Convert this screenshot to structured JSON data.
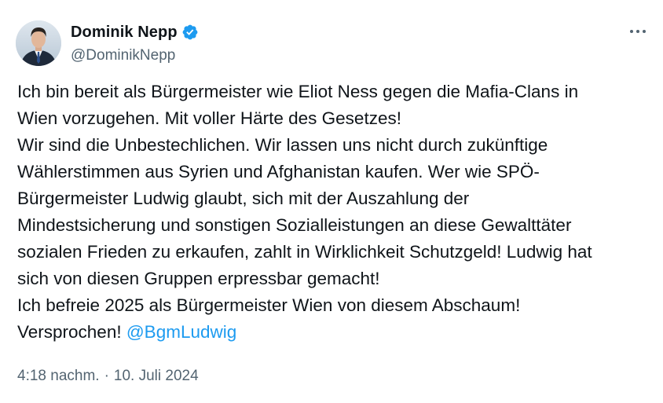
{
  "author": {
    "display_name": "Dominik Nepp",
    "handle": "@DominikNepp",
    "avatar_icon": "profile-photo",
    "verified_icon": "verified-badge-icon",
    "verified_color": "#1d9bf0"
  },
  "menu": {
    "icon": "more-options-icon"
  },
  "tweet": {
    "text": "Ich bin bereit als Bürgermeister wie Eliot Ness gegen die Mafia-Clans in\nWien vorzugehen. Mit voller Härte des Gesetzes!\nWir sind die Unbestechlichen. Wir lassen uns nicht durch zukünftige\nWählerstimmen aus Syrien und Afghanistan kaufen. Wer wie SPÖ-\nBürgermeister Ludwig glaubt, sich mit der Auszahlung der\nMindestsicherung und sonstigen Sozialleistungen an diese Gewalttäter\nsozialen Frieden zu erkaufen, zahlt in Wirklichkeit Schutzgeld! Ludwig hat\nsich von diesen Gruppen erpressbar gemacht!\nIch befreie 2025 als Bürgermeister Wien von diesem Abschaum!\nVersprochen! ",
    "mention": "@BgmLudwig",
    "mention_color": "#1d9bf0"
  },
  "meta": {
    "time": "4:18 nachm.",
    "separator": "·",
    "date": "10. Juli 2024"
  },
  "colors": {
    "text": "#0f1419",
    "secondary": "#536471",
    "background": "#ffffff"
  }
}
